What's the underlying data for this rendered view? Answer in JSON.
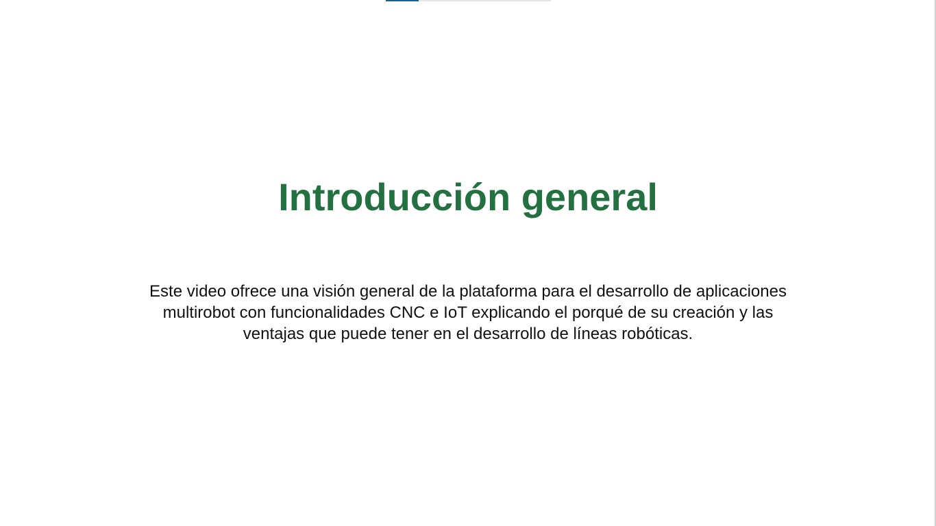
{
  "progress": {
    "fraction": 0.2,
    "fill_color": "#1f5f8b"
  },
  "slide": {
    "title": "Introducción general",
    "title_color": "#237040",
    "description": "Este video ofrece una visión general de la plataforma para el desarrollo de aplicaciones multirobot con funcionalidades CNC e IoT explicando el porqué de su creación y las ventajas que puede tener en el desarrollo de líneas robóticas."
  }
}
